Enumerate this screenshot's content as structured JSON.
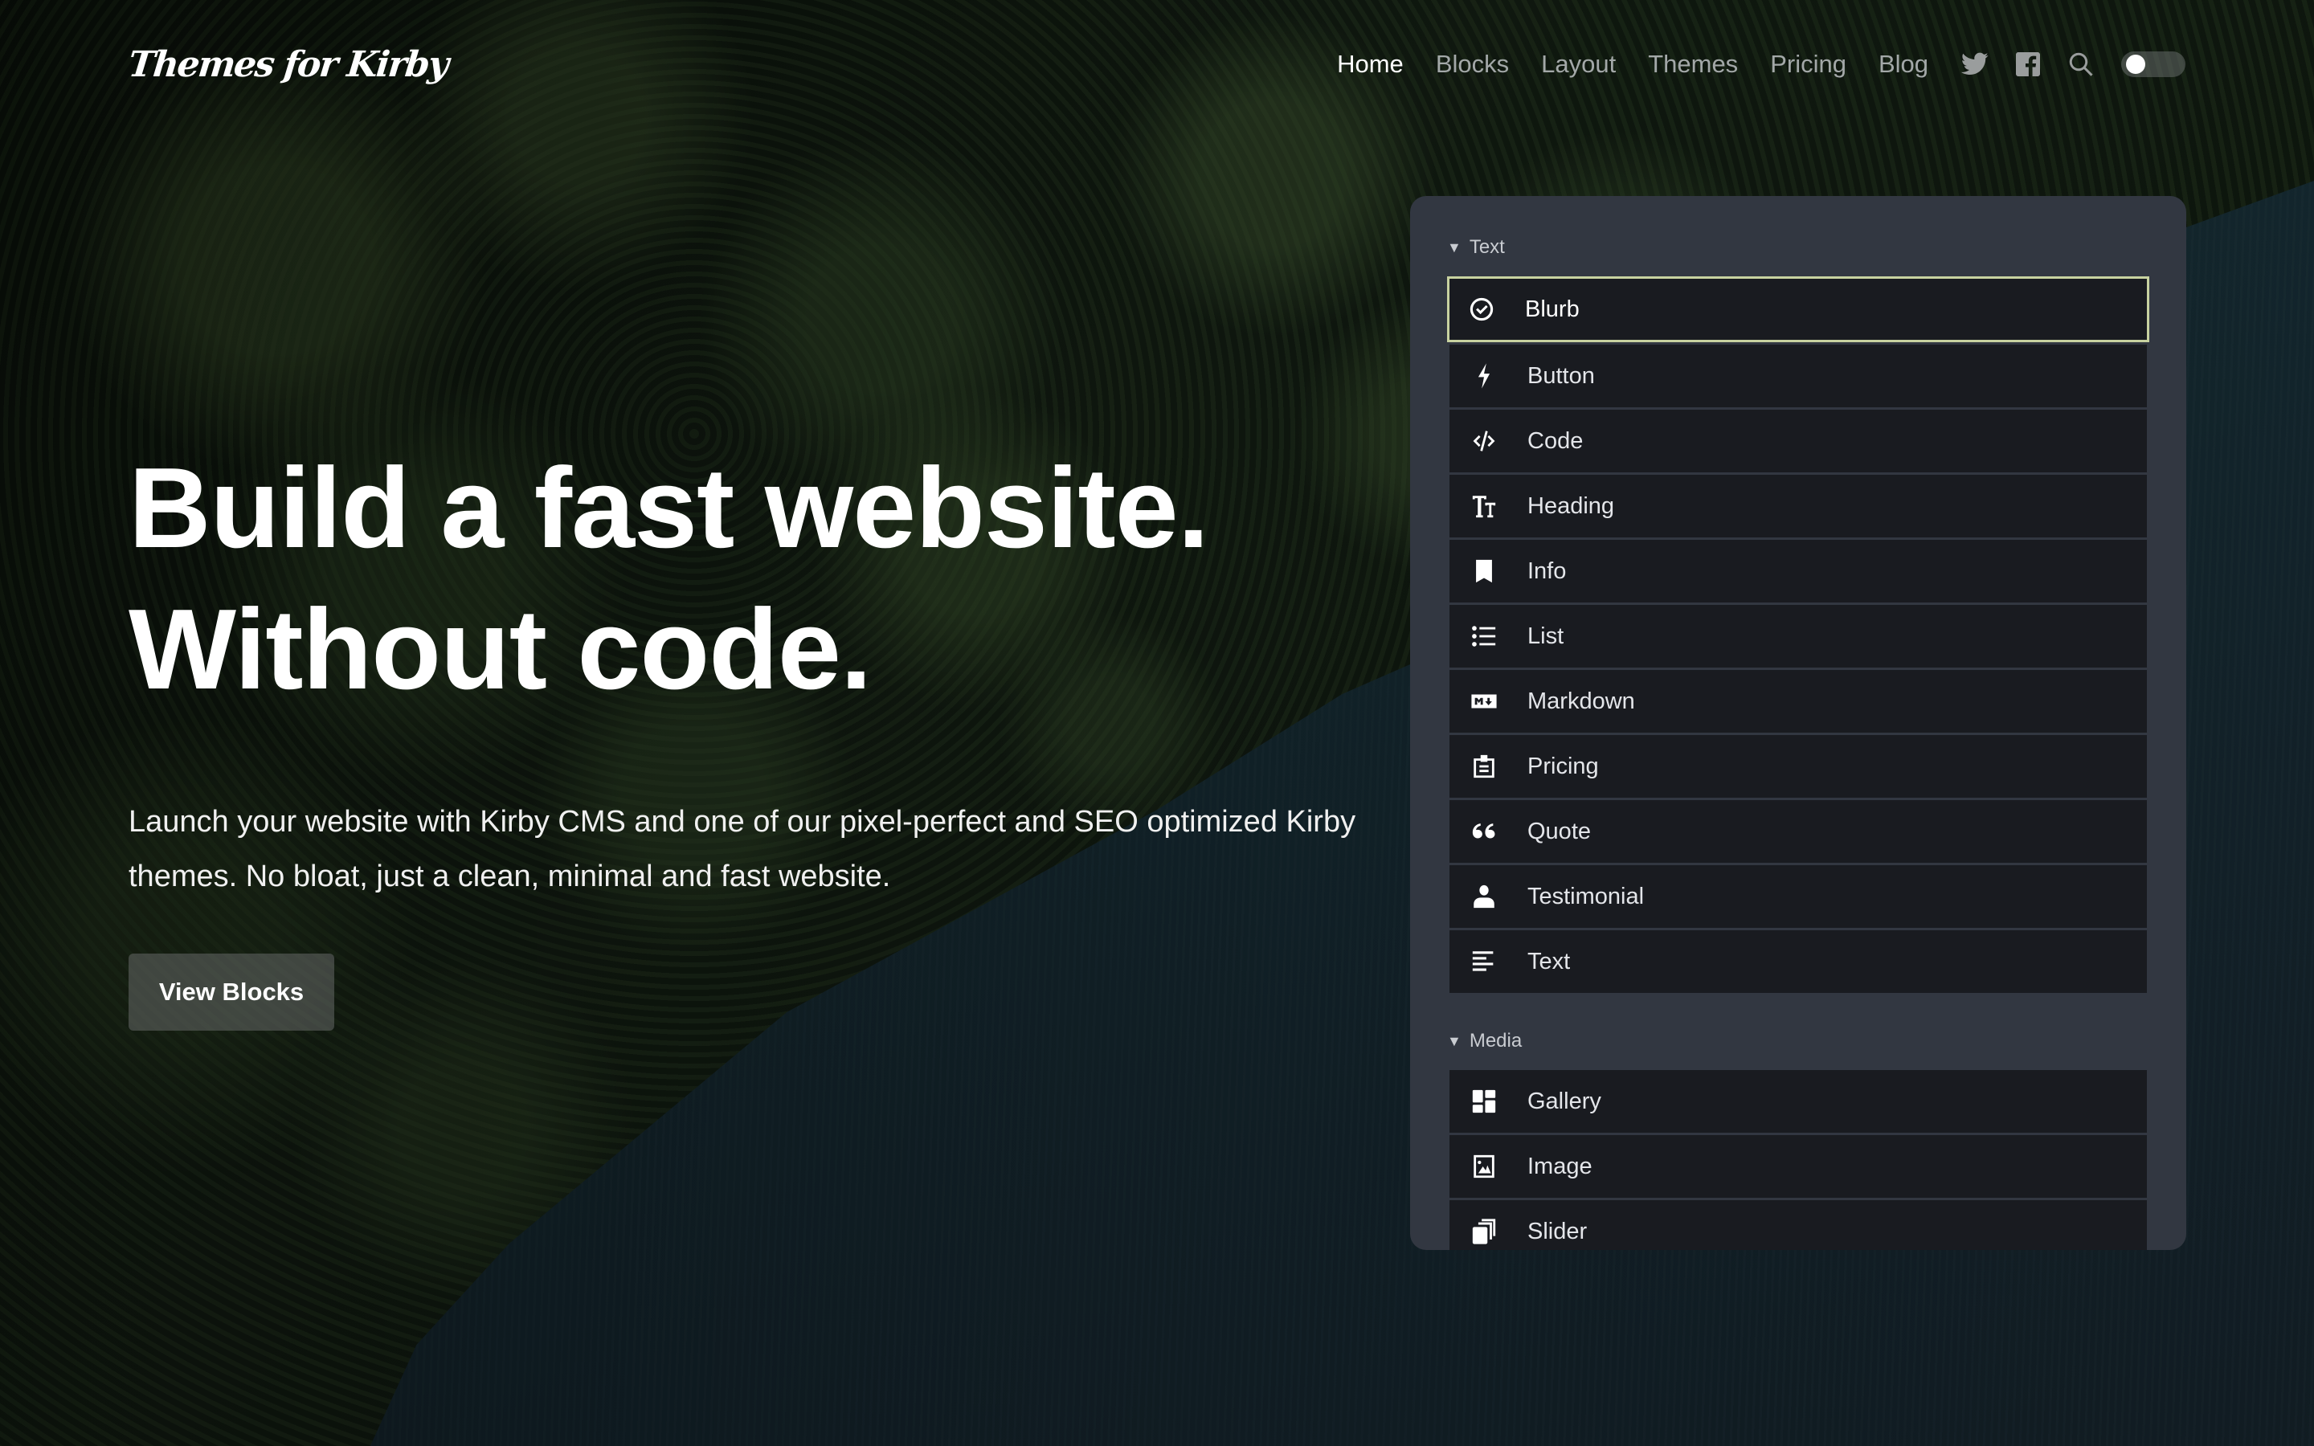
{
  "header": {
    "logo": "Themes for Kirby",
    "nav": [
      {
        "label": "Home",
        "active": true
      },
      {
        "label": "Blocks",
        "active": false
      },
      {
        "label": "Layout",
        "active": false
      },
      {
        "label": "Themes",
        "active": false
      },
      {
        "label": "Pricing",
        "active": false
      },
      {
        "label": "Blog",
        "active": false
      }
    ],
    "icons": [
      "twitter-icon",
      "facebook-icon",
      "search-icon"
    ],
    "theme_toggle": {
      "state": "off"
    }
  },
  "hero": {
    "title_line1": "Build a fast website.",
    "title_line2": "Without code.",
    "subtitle": "Launch your website with Kirby CMS and one of our pixel-perfect and SEO optimized Kirby themes. No bloat, just a clean, minimal and fast website.",
    "cta_label": "View Blocks"
  },
  "panel": {
    "groups": [
      {
        "title": "Text",
        "items": [
          {
            "label": "Blurb",
            "icon": "check-circle-icon",
            "selected": true
          },
          {
            "label": "Button",
            "icon": "bolt-icon"
          },
          {
            "label": "Code",
            "icon": "code-icon"
          },
          {
            "label": "Heading",
            "icon": "text-size-icon"
          },
          {
            "label": "Info",
            "icon": "bookmark-icon"
          },
          {
            "label": "List",
            "icon": "list-icon"
          },
          {
            "label": "Markdown",
            "icon": "markdown-icon"
          },
          {
            "label": "Pricing",
            "icon": "clipboard-icon"
          },
          {
            "label": "Quote",
            "icon": "quote-icon"
          },
          {
            "label": "Testimonial",
            "icon": "user-icon"
          },
          {
            "label": "Text",
            "icon": "align-left-icon"
          }
        ]
      },
      {
        "title": "Media",
        "items": [
          {
            "label": "Gallery",
            "icon": "dashboard-icon"
          },
          {
            "label": "Image",
            "icon": "image-icon"
          },
          {
            "label": "Slider",
            "icon": "copy-icon"
          }
        ]
      }
    ]
  },
  "colors": {
    "selected_border": "#c8d2a0",
    "panel_bg": "#323741",
    "item_bg": "#191b20",
    "nav_inactive": "#a3a8a8"
  }
}
